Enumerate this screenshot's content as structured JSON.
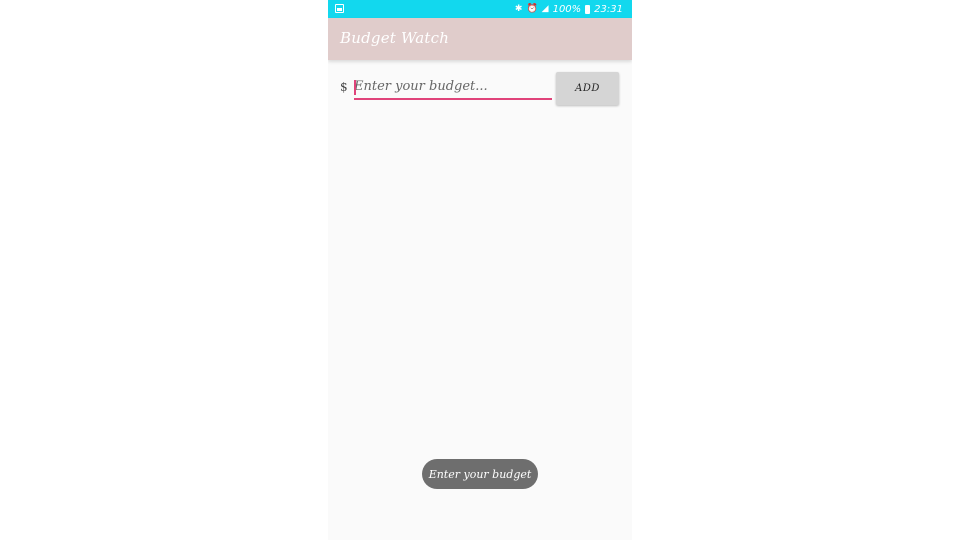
{
  "status_bar": {
    "left_icon": "image-notification-icon",
    "icons": [
      "bluetooth-icon",
      "alarm-icon",
      "signal-icon"
    ],
    "battery": "100%",
    "time": "23:31"
  },
  "app_bar": {
    "title": "Budget Watch"
  },
  "budget_form": {
    "currency_symbol": "$",
    "placeholder": "Enter your budget...",
    "value": "",
    "add_label": "ADD"
  },
  "toast": {
    "message": "Enter your budget"
  },
  "colors": {
    "status_bar": "#12d8ee",
    "app_bar": "#e0cccb",
    "accent": "#e0437a",
    "background": "#fafafa",
    "toast": "#6e6e6e"
  }
}
